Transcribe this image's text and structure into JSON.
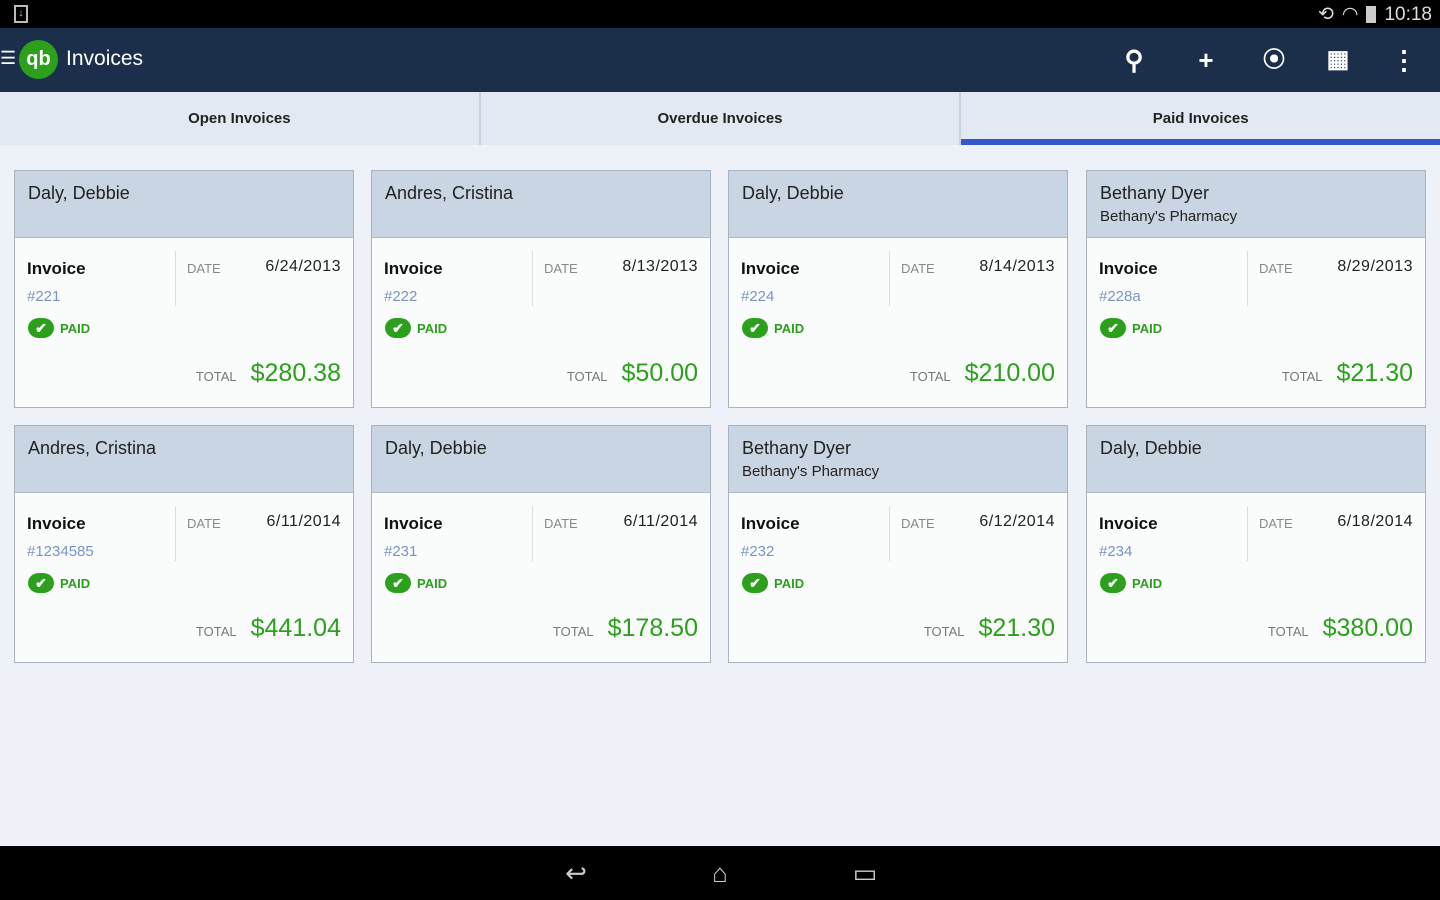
{
  "status": {
    "time": "10:18"
  },
  "appbar": {
    "logo": "qb",
    "title": "Invoices",
    "icons": [
      "search-icon",
      "plus-icon",
      "location-alert-icon",
      "grid-icon",
      "more-vert-icon"
    ]
  },
  "tabs": [
    {
      "label": "Open Invoices"
    },
    {
      "label": "Overdue Invoices"
    },
    {
      "label": "Paid Invoices",
      "active": true
    }
  ],
  "labels": {
    "invoice": "Invoice",
    "date": "DATE",
    "paid": "PAID",
    "total": "TOTAL"
  },
  "colors": {
    "accent": "#2ca01c",
    "appbar": "#1b2f4b",
    "tab_indicator": "#3457c8"
  },
  "cards": [
    {
      "name": "Daly, Debbie",
      "company": "",
      "number": "#221",
      "date": "6/24/2013",
      "total": "$280.38"
    },
    {
      "name": "Andres, Cristina",
      "company": "",
      "number": "#222",
      "date": "8/13/2013",
      "total": "$50.00"
    },
    {
      "name": "Daly, Debbie",
      "company": "",
      "number": "#224",
      "date": "8/14/2013",
      "total": "$210.00"
    },
    {
      "name": "Bethany Dyer",
      "company": "Bethany's Pharmacy",
      "number": "#228a",
      "date": "8/29/2013",
      "total": "$21.30"
    },
    {
      "name": "Andres, Cristina",
      "company": "",
      "number": "#1234585",
      "date": "6/11/2014",
      "total": "$441.04"
    },
    {
      "name": "Daly, Debbie",
      "company": "",
      "number": "#231",
      "date": "6/11/2014",
      "total": "$178.50"
    },
    {
      "name": "Bethany Dyer",
      "company": "Bethany's Pharmacy",
      "number": "#232",
      "date": "6/12/2014",
      "total": "$21.30"
    },
    {
      "name": "Daly, Debbie",
      "company": "",
      "number": "#234",
      "date": "6/18/2014",
      "total": "$380.00"
    }
  ]
}
